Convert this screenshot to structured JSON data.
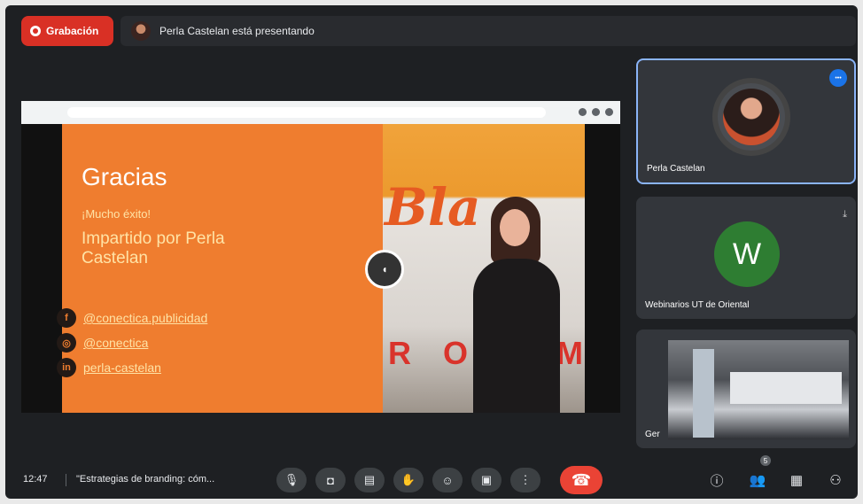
{
  "header": {
    "record_label": "Grabación",
    "presenting_text": "Perla Castelan está presentando"
  },
  "slide": {
    "title": "Gracias",
    "subtitle": "¡Mucho éxito!",
    "presented_by": "Impartido por Perla Castelan",
    "social": [
      {
        "icon": "f",
        "text": "@conectica.publicidad"
      },
      {
        "icon": "◎",
        "text": "@conectica"
      },
      {
        "icon": "in",
        "text": "perla-castelan"
      }
    ],
    "photo_sign": "Bla",
    "photo_letters": [
      "R",
      "O",
      "O",
      "M"
    ],
    "pointer_glyph": "◖"
  },
  "participants": [
    {
      "name": "Perla Castelan",
      "badge": "•••"
    },
    {
      "name": "Webinarios UT de Oriental",
      "initial": "W",
      "mic": "⤓"
    },
    {
      "name": "Ger"
    }
  ],
  "bottom": {
    "time": "12:47",
    "meeting_title": "\"Estrategias de branding: cóm...",
    "participant_count": "5",
    "icons": {
      "mic": "🎙",
      "camera": "◘",
      "captions": "▤",
      "hand": "✋",
      "emoji": "☺",
      "present": "▣",
      "more": "⋮",
      "end": "☎",
      "info": "ⓘ",
      "people": "👥",
      "chat": "▦",
      "activities": "⚇"
    }
  }
}
